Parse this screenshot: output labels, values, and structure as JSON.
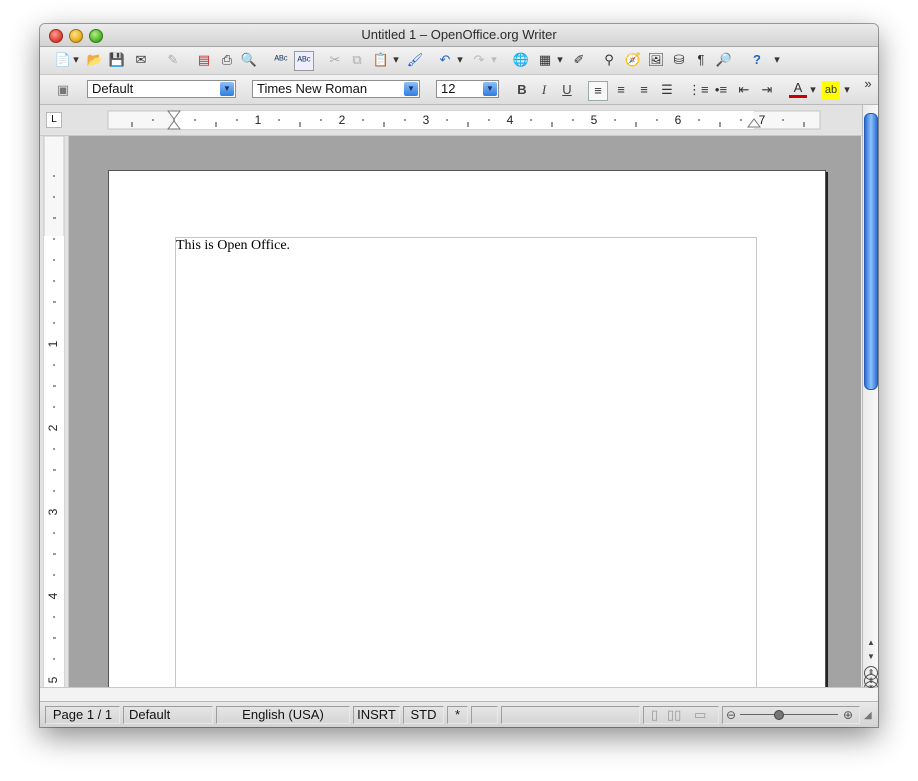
{
  "window": {
    "title": "Untitled 1 – OpenOffice.org Writer"
  },
  "toolbar_standard": {
    "icons": [
      "new-icon",
      "open-icon",
      "save-icon",
      "email-icon",
      "edit-file-icon",
      "export-pdf-icon",
      "print-icon",
      "page-preview-icon",
      "spellcheck-icon",
      "autospellcheck-icon",
      "cut-icon",
      "copy-icon",
      "paste-icon",
      "format-paintbrush-icon",
      "undo-icon",
      "redo-icon",
      "hyperlink-icon",
      "table-icon",
      "draw-functions-icon",
      "find-replace-icon",
      "navigator-icon",
      "gallery-icon",
      "data-sources-icon",
      "formatting-marks-icon",
      "zoom-icon",
      "help-icon"
    ],
    "overflow_label": "»"
  },
  "toolbar_formatting": {
    "paragraph_style": "Default",
    "font_name": "Times New Roman",
    "font_size": "12",
    "bold_label": "B",
    "italic_label": "I",
    "underline_label": "U"
  },
  "ruler": {
    "corner_label": "L",
    "h_numbers": [
      "1",
      "2",
      "3",
      "4",
      "5",
      "6",
      "7"
    ],
    "v_numbers": [
      "1",
      "2",
      "3",
      "4",
      "5"
    ]
  },
  "document": {
    "text": "This is Open Office."
  },
  "statusbar": {
    "page": "Page 1 / 1",
    "page_style": "Default",
    "language": "English (USA)",
    "insert_mode": "INSRT",
    "selection_mode": "STD",
    "modified": "*"
  },
  "colors": {
    "accent": "#2e7ee0",
    "doc_background": "#a3a3a3"
  }
}
